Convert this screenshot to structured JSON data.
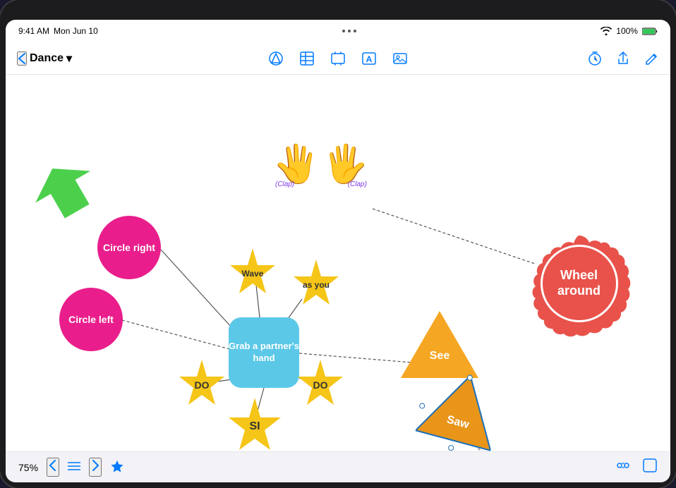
{
  "status": {
    "time": "9:41 AM",
    "date": "Mon Jun 10",
    "wifi": "100%",
    "battery": "100%",
    "dots": [
      "•",
      "•",
      "•"
    ]
  },
  "toolbar": {
    "back_label": "‹",
    "title": "Dance",
    "title_arrow": "▾",
    "center_icons": [
      "shape",
      "table",
      "image-frame",
      "text",
      "photo"
    ],
    "right_icons": [
      "timer",
      "share",
      "edit"
    ]
  },
  "canvas": {
    "green_arrow_label": "",
    "circle_right_label": "Circle\nright",
    "circle_left_label": "Circle\nleft",
    "center_node_label": "Grab a\npartner's\nhand",
    "wave_label": "Wave",
    "as_you_label": "as\nyou",
    "do_left_label": "DO",
    "si_label": "SI",
    "do_right_label": "DO",
    "clap_left_label": "(Clap)",
    "clap_right_label": "(Clap)",
    "see_label": "See",
    "saw_label": "Saw",
    "wheel_around_label": "Wheel\naround"
  },
  "bottom_bar": {
    "zoom": "75%",
    "star_active": true,
    "right_icons": [
      "distribute",
      "square"
    ]
  }
}
